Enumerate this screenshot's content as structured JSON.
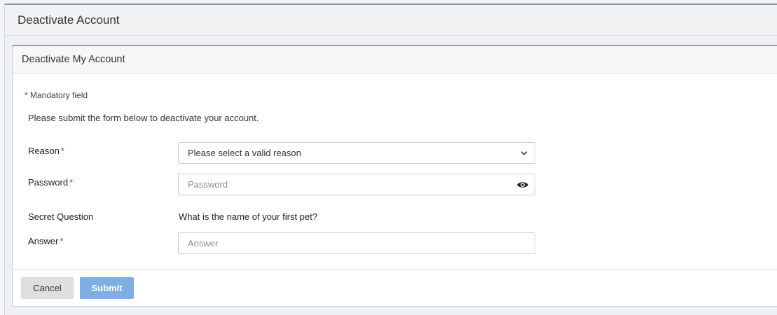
{
  "page": {
    "title": "Deactivate Account"
  },
  "panel": {
    "title": "Deactivate My Account"
  },
  "form": {
    "mandatory_star": "*",
    "mandatory_note": "Mandatory field",
    "instruction": "Please submit the form below to deactivate your account.",
    "reason": {
      "label": "Reason",
      "required_star": "*",
      "selected": "Please select a valid reason"
    },
    "password": {
      "label": "Password",
      "required_star": "*",
      "placeholder": "Password"
    },
    "secret_question": {
      "label": "Secret Question",
      "value": "What is the name of your first pet?"
    },
    "answer": {
      "label": "Answer",
      "required_star": "*",
      "placeholder": "Answer"
    }
  },
  "buttons": {
    "cancel": "Cancel",
    "submit": "Submit"
  },
  "icons": {
    "select": "chevron-down-icon",
    "password_toggle": "eye-icon"
  },
  "colors": {
    "required": "#e0262c",
    "submit": "#7eaee4",
    "panel_accent": "#7aa9dd"
  }
}
